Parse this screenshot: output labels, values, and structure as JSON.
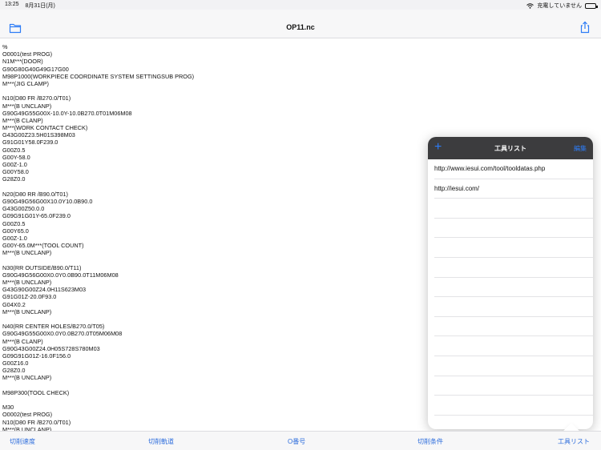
{
  "status": {
    "time": "13:25",
    "date": "8月31日(月)",
    "charging": "充電していません"
  },
  "header": {
    "title": "OP11.nc"
  },
  "code_lines": [
    "%",
    "O0001(test PROG)",
    "N1M***(DOOR)",
    "G90G80G40G49G17G00",
    "M98P1000(WORKPIECE COORDINATE SYSTEM SETTINGSUB PROG)",
    "M***(JIG CLAMP)",
    "",
    "N10(D80 FR /B270.0/T01)",
    "M***(B UNCLANP)",
    "G90G49G55G00X-10.0Y-10.0B270.0T01M06M08",
    "M***(B CLANP)",
    "M***(WORK CONTACT CHECK)",
    "G43G00Z23.5H01S398M03",
    "G91G01Y58.0F239.0",
    "G00Z0.5",
    "G00Y-58.0",
    "G00Z-1.0",
    "G00Y58.0",
    "G28Z0.0",
    "",
    "N20(D80 RR /B90.0/T01)",
    "G90G49G56G00X10.0Y10.0B90.0",
    "G43G00Z50.0.0",
    "G09G91G01Y-65.0F239.0",
    "G00Z0.5",
    "G00Y65.0",
    "G00Z-1.0",
    "G00Y-65.0M***(TOOL COUNT)",
    "M***(B UNCLANP)",
    "",
    "N30(RR OUTSIDE/B90.0/T11)",
    "G90G49G56G00X0.0Y0.0B90.0T11M06M08",
    "M***(B UNCLANP)",
    "G43G90G00Z24.0H11S623M03",
    "G91G01Z-20.0F93.0",
    "G04X0.2",
    "M***(B UNCLANP)",
    "",
    "N40(RR CENTER HOLES/B270.0/T05)",
    "G90G49G55G00X0.0Y0.0B270.0T05M06M08",
    "M***(B CLANP)",
    "G90G43G00Z24.0H05S728S780M03",
    "G09G91G01Z-16.0F156.0",
    "G00Z16.0",
    "G28Z0.0",
    "M***(B UNCLANP)",
    "",
    "M98P300(TOOL CHECK)",
    "",
    "M30",
    "O0002(test PROG)",
    "N10(D80 FR /B270.0/T01)",
    "M***(B UNCLANP)"
  ],
  "tabs": [
    "切削速度",
    "切削軌道",
    "O番号",
    "切削条件",
    "工具リスト"
  ],
  "tool_list": {
    "title": "工具リスト",
    "add": "+",
    "edit": "編集",
    "items": [
      "http://www.iesui.com/tool/tooldatas.php",
      "http://iesui.com/"
    ],
    "empty_rows": 12
  },
  "colors": {
    "accent": "#2d7cf6",
    "tab_text": "#2d6ddc",
    "popover_header": "#3c3c3e"
  }
}
